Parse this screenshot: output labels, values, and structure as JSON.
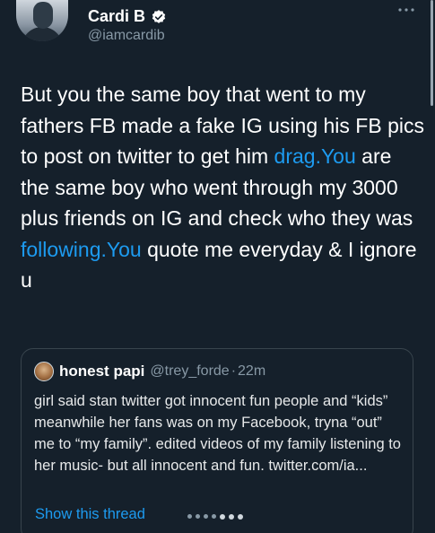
{
  "author": {
    "display_name": "Cardi B",
    "handle": "@iamcardib",
    "verified": true
  },
  "tweet": {
    "segments": [
      {
        "text": "But you the same boy that went to my fathers FB made a fake IG using his FB pics to post on twitter to get him ",
        "link": false
      },
      {
        "text": "drag.You",
        "link": true
      },
      {
        "text": " are the same boy who went through my 3000 plus friends on IG and check who they was ",
        "link": false
      },
      {
        "text": "following.You",
        "link": true
      },
      {
        "text": " quote me everyday & I ignore u",
        "link": false
      }
    ]
  },
  "quoted_tweet": {
    "display_name": "honest papi",
    "handle": "@trey_forde",
    "separator": "·",
    "time": "22m",
    "text": "girl said stan twitter got innocent fun people and “kids” meanwhile her fans was on my Facebook, tryna “out” me to “my family”. edited videos of my family listening to her music- but all innocent and fun. twitter.com/ia...",
    "show_thread_label": "Show this thread"
  },
  "icons": {
    "more": "more-horizontal-icon",
    "verified": "verified-badge-icon"
  },
  "colors": {
    "background": "#15202b",
    "link": "#1d9bf0",
    "secondary_text": "#8899a6",
    "border": "#38444d"
  }
}
